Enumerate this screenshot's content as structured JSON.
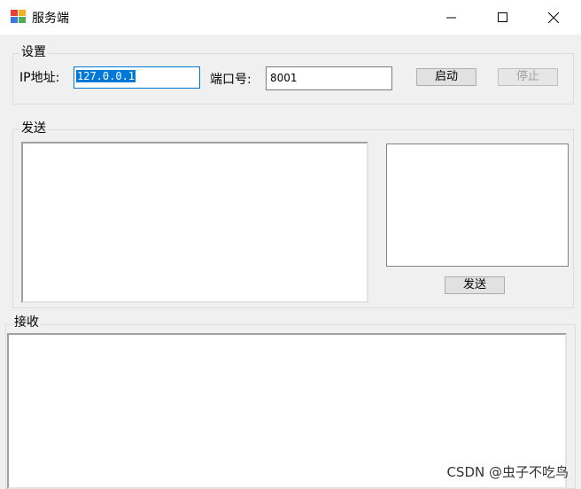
{
  "window": {
    "title": "服务端",
    "minimize_glyph": "—",
    "maximize_glyph": "☐",
    "close_glyph": "✕"
  },
  "settings": {
    "group_label": "设置",
    "ip_label": "IP地址:",
    "ip_value": "127.0.0.1",
    "port_label": "端口号:",
    "port_value": "8001",
    "start_button": "启动",
    "stop_button": "停止"
  },
  "send": {
    "group_label": "发送",
    "send_button": "发送"
  },
  "receive": {
    "group_label": "接收"
  },
  "watermark": "CSDN @虫子不吃鸟",
  "colors": {
    "selection": "#0078d7",
    "focus_border": "#0078d7"
  }
}
